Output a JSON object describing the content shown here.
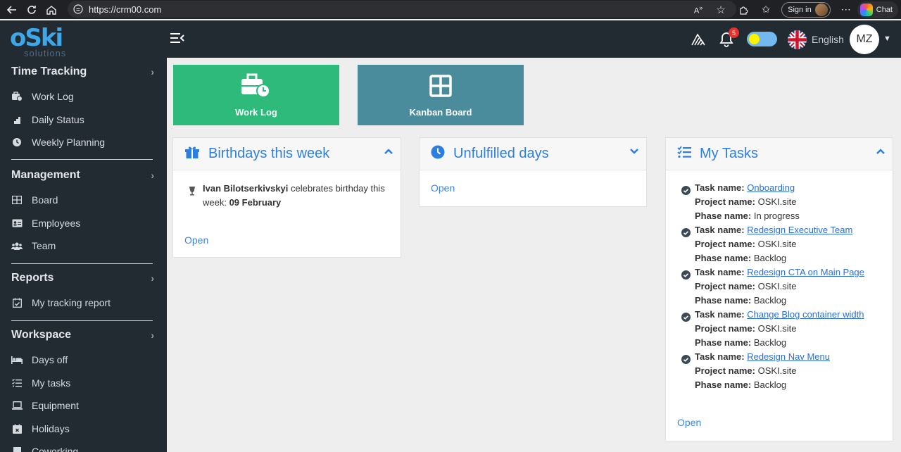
{
  "browser": {
    "url": "https://crm00.com",
    "signin_label": "Sign in",
    "chat_label": "Chat"
  },
  "logo": {
    "main": "oSki",
    "sub": "solutions"
  },
  "sidebar": {
    "sections": [
      {
        "title": "Time Tracking",
        "items": [
          {
            "label": "Work Log",
            "icon": "briefcase-clock-icon"
          },
          {
            "label": "Daily Status",
            "icon": "stairs-icon"
          },
          {
            "label": "Weekly Planning",
            "icon": "clock-icon"
          }
        ]
      },
      {
        "title": "Management",
        "items": [
          {
            "label": "Board",
            "icon": "grid-icon"
          },
          {
            "label": "Employees",
            "icon": "id-card-icon"
          },
          {
            "label": "Team",
            "icon": "users-icon"
          }
        ]
      },
      {
        "title": "Reports",
        "items": [
          {
            "label": "My tracking report",
            "icon": "calendar-check-icon"
          }
        ]
      },
      {
        "title": "Workspace",
        "items": [
          {
            "label": "Days off",
            "icon": "bed-icon"
          },
          {
            "label": "My tasks",
            "icon": "tasks-icon"
          },
          {
            "label": "Equipment",
            "icon": "laptop-icon"
          },
          {
            "label": "Holidays",
            "icon": "calendar-x-icon"
          },
          {
            "label": "Coworking",
            "icon": "building-icon"
          }
        ]
      }
    ]
  },
  "header": {
    "notification_count": "5",
    "language": "English",
    "user_initials": "MZ"
  },
  "tiles": [
    {
      "label": "Work Log",
      "color": "#2dba7a"
    },
    {
      "label": "Kanban Board",
      "color": "#4a8b9c"
    }
  ],
  "birthdays": {
    "title": "Birthdays this week",
    "person": "Ivan Bilotserkivskyi",
    "text_mid": " celebrates birthday this week: ",
    "date": "09 February",
    "open": "Open"
  },
  "unfulfilled": {
    "title": "Unfulfilled days",
    "open": "Open"
  },
  "tasks": {
    "title": "My Tasks",
    "task_label": "Task name:",
    "project_label": "Project name:",
    "phase_label": "Phase name:",
    "items": [
      {
        "name": "Onboarding",
        "project": "OSKI.site",
        "phase": "In progress"
      },
      {
        "name": "Redesign Executive Team",
        "project": "OSKI.site",
        "phase": "Backlog"
      },
      {
        "name": "Redesign CTA on Main Page",
        "project": "OSKI.site",
        "phase": "Backlog"
      },
      {
        "name": "Change Blog container width",
        "project": "OSKI.site",
        "phase": "Backlog"
      },
      {
        "name": "Redesign Nav Menu",
        "project": "OSKI.site",
        "phase": "Backlog"
      }
    ],
    "open": "Open"
  }
}
